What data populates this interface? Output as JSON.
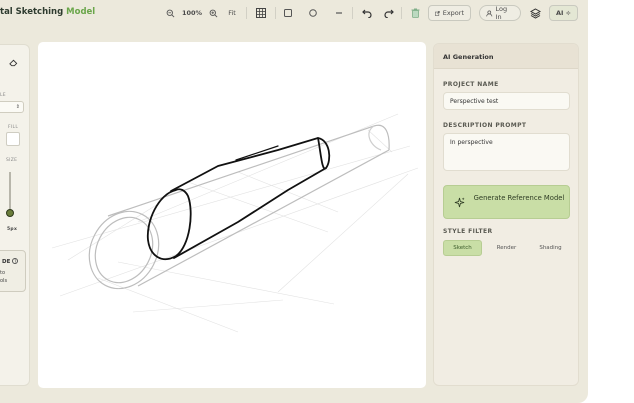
{
  "brand": {
    "prefix": "tal Sketching ",
    "accent": "Model",
    "accent_color": "#6aa64a"
  },
  "toolbar": {
    "zoom_out_icon": "zoom-out-icon",
    "zoom_level": "100%",
    "zoom_in_icon": "zoom-in-icon",
    "fit_label": "Fit",
    "grid_icon": "grid-icon",
    "rectangle_icon": "square-icon",
    "circle_icon": "circle-icon",
    "line_icon": "line-icon",
    "undo_icon": "undo-icon",
    "redo_icon": "redo-icon",
    "delete_icon": "trash-icon",
    "export_label": "Export",
    "login_label": "Log In",
    "layers_icon": "layers-icon",
    "ai_label": "AI"
  },
  "left_panel": {
    "style_label": "LE",
    "fill_label": "FILL",
    "size_label": "SIZE",
    "size_value": "5px",
    "guide_title": "DE",
    "guide_line1": "to",
    "guide_line2": "ols"
  },
  "ai_panel": {
    "title": "AI Generation",
    "project_name_label": "PROJECT NAME",
    "project_name_value": "Perspective test",
    "description_label": "DESCRIPTION PROMPT",
    "description_value": "In perspective",
    "generate_label": "Generate Reference Model",
    "style_filter_label": "STYLE FILTER",
    "style_options": [
      {
        "label": "Sketch",
        "active": true
      },
      {
        "label": "Render",
        "active": false
      },
      {
        "label": "Shading",
        "active": false
      }
    ],
    "accent_green": "#c9dea6"
  }
}
